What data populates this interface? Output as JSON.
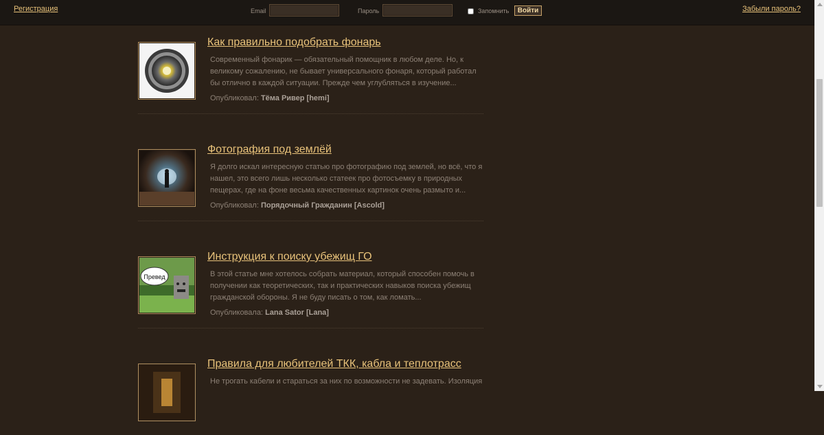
{
  "header": {
    "register_link": "Регистрация",
    "email_label": "Email",
    "password_label": "Пароль",
    "remember_label": "Запомнить",
    "login_button": "Войти",
    "forgot_link": "Забыли пароль?"
  },
  "articles": [
    {
      "title": "Как правильно подобрать фонарь",
      "excerpt": "Современный фонарик — обязательный помощник в любом деле. Но, к великому сожалению, не бывает универсального фонаря, который работал бы отлично в каждой ситуации. Прежде чем углубляться в изучение...",
      "author_label": "Опубликовал:",
      "author": "Тёма Ривер [hemi]",
      "thumb_icon": "flashlight-icon"
    },
    {
      "title": "Фотография под землёй",
      "excerpt": "Я долго искал интересную статью про фотографию под землей, но всё, что я нашел, это всего лишь несколько статеек про фотосъемку в природных пещерах, где на фоне весьма качественных картинок очень размыто и...",
      "author_label": "Опубликовал:",
      "author": "Порядочный Гражданин [Ascold]",
      "thumb_icon": "tunnel-photo-icon"
    },
    {
      "title": "Инструкция к поиску убежищ ГО",
      "excerpt": "В этой статье мне хотелось собрать материал, который способен помочь в получении как теоретических, так и практических навыков поиска убежищ гражданской обороны. Я не буду писать о том, как ломать...",
      "author_label": "Опубликовала:",
      "author": "Lana Sator [Lana]",
      "thumb_icon": "preved-bear-icon",
      "thumb_caption": "Превед"
    },
    {
      "title": "Правила для любителей ТКК, кабла и теплотрасс",
      "excerpt": "Не трогать кабели и стараться за них по возможности не задевать. Изоляция",
      "author_label": "",
      "author": "",
      "thumb_icon": "corridor-photo-icon"
    }
  ]
}
